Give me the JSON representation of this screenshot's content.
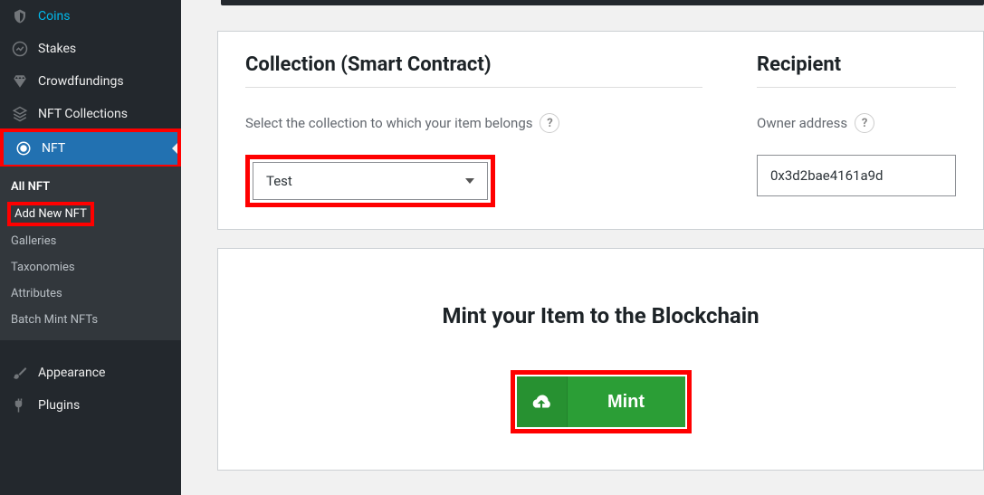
{
  "sidebar": {
    "items": [
      {
        "label": "Coins"
      },
      {
        "label": "Stakes"
      },
      {
        "label": "Crowdfundings"
      },
      {
        "label": "NFT Collections"
      },
      {
        "label": "NFT"
      },
      {
        "label": "Appearance"
      },
      {
        "label": "Plugins"
      }
    ],
    "submenu": [
      {
        "label": "All NFT"
      },
      {
        "label": "Add New NFT"
      },
      {
        "label": "Galleries"
      },
      {
        "label": "Taxonomies"
      },
      {
        "label": "Attributes"
      },
      {
        "label": "Batch Mint NFTs"
      }
    ]
  },
  "main": {
    "collection": {
      "title": "Collection (Smart Contract)",
      "hint": "Select the collection to which your item belongs",
      "selected": "Test"
    },
    "recipient": {
      "title": "Recipient",
      "hint": "Owner address",
      "value": "0x3d2bae4161a9d"
    },
    "mint": {
      "title": "Mint your Item to the Blockchain",
      "button": "Mint"
    }
  }
}
